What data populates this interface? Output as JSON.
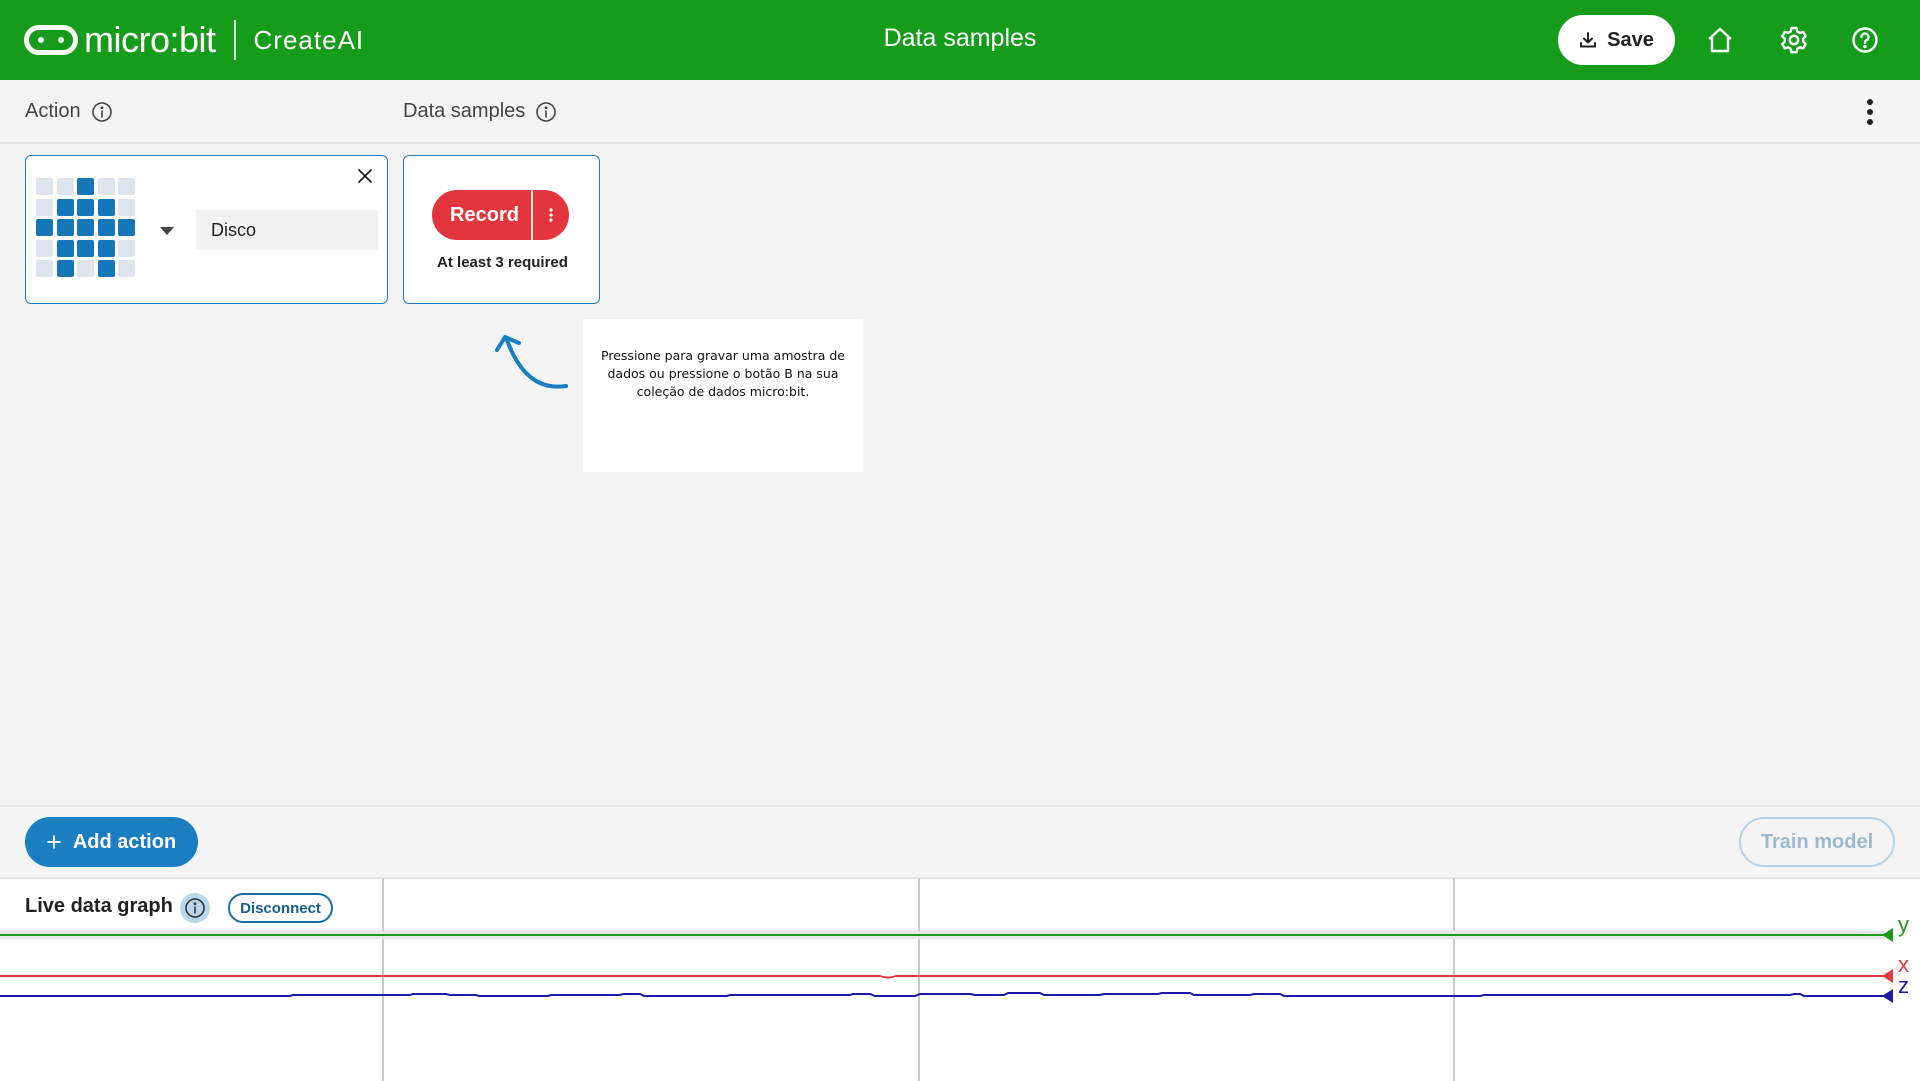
{
  "header": {
    "brand": "micro:bit",
    "product": "CreateAI",
    "title": "Data samples",
    "save_label": "Save",
    "bg_color": "#169c1b"
  },
  "columns": {
    "action_label": "Action",
    "samples_label": "Data samples"
  },
  "action": {
    "name": "Disco",
    "icon_grid": [
      [
        0,
        0,
        1,
        0,
        0
      ],
      [
        0,
        1,
        1,
        1,
        0
      ],
      [
        1,
        1,
        1,
        1,
        1
      ],
      [
        0,
        1,
        1,
        1,
        0
      ],
      [
        0,
        1,
        0,
        1,
        0
      ]
    ]
  },
  "record": {
    "label": "Record",
    "requirement": "At least 3 required"
  },
  "tooltip": {
    "text": "Pressione para gravar uma amostra de dados ou pressione o botão B na sua coleção de dados micro:bit."
  },
  "footer": {
    "add_action_label": "Add action",
    "train_label": "Train model"
  },
  "graph": {
    "title": "Live data graph",
    "disconnect_label": "Disconnect",
    "series": [
      {
        "name": "y",
        "color": "#1e9a1e"
      },
      {
        "name": "x",
        "color": "#e23b3b"
      },
      {
        "name": "z",
        "color": "#1a1aa8"
      }
    ]
  }
}
